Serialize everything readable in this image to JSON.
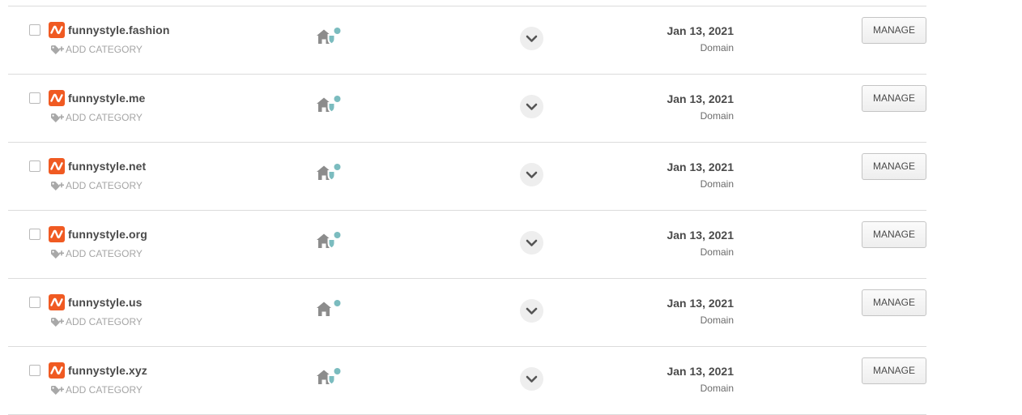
{
  "domains": [
    {
      "name": "funnystyle.fashion",
      "add_category": "ADD CATEGORY",
      "date": "Jan 13, 2021",
      "type": "Domain",
      "action": "MANAGE",
      "privacy_shield": true
    },
    {
      "name": "funnystyle.me",
      "add_category": "ADD CATEGORY",
      "date": "Jan 13, 2021",
      "type": "Domain",
      "action": "MANAGE",
      "privacy_shield": true
    },
    {
      "name": "funnystyle.net",
      "add_category": "ADD CATEGORY",
      "date": "Jan 13, 2021",
      "type": "Domain",
      "action": "MANAGE",
      "privacy_shield": true
    },
    {
      "name": "funnystyle.org",
      "add_category": "ADD CATEGORY",
      "date": "Jan 13, 2021",
      "type": "Domain",
      "action": "MANAGE",
      "privacy_shield": true
    },
    {
      "name": "funnystyle.us",
      "add_category": "ADD CATEGORY",
      "date": "Jan 13, 2021",
      "type": "Domain",
      "action": "MANAGE",
      "privacy_shield": false
    },
    {
      "name": "funnystyle.xyz",
      "add_category": "ADD CATEGORY",
      "date": "Jan 13, 2021",
      "type": "Domain",
      "action": "MANAGE",
      "privacy_shield": true
    }
  ],
  "icons": {
    "brand": "namecheap-logo-icon",
    "tag": "tag-plus-icon",
    "home": "home-icon",
    "shield": "shield-icon",
    "status_dot": "status-dot-icon",
    "expand": "chevron-down-icon"
  },
  "colors": {
    "brand": "#f05a22",
    "status_dot": "#7bbcbf",
    "shield": "#7bbcbf",
    "icon_gray": "#8c8c8c"
  }
}
